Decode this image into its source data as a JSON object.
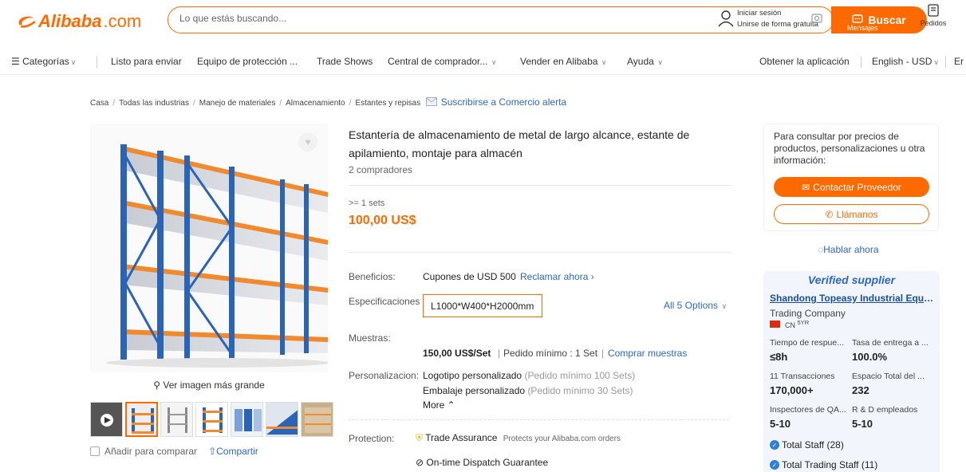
{
  "header": {
    "logo_text": "Alibaba",
    "logo_suffix": ".com",
    "search_placeholder": "Lo que estás buscando...",
    "signin_line1": "Iniciar sesión",
    "signin_line2": "Unirse de forma gratuita",
    "search_button": "Buscar",
    "messages_label": "Mensajes",
    "orders_label": "Pedidos"
  },
  "nav": {
    "categories": "Categorías",
    "items": [
      "Listo para enviar",
      "Equipo de protección ...",
      "Trade Shows",
      "Central de comprador...",
      "Vender en Alibaba",
      "Ayuda"
    ],
    "get_app": "Obtener la aplicación",
    "language": "English - USD",
    "more": "Er"
  },
  "breadcrumb": {
    "items": [
      "Casa",
      "Todas las industrias",
      "Manejo de materiales",
      "Almacenamiento",
      "Estantes y repisas"
    ],
    "subscribe": "Suscribirse a Comercio alerta"
  },
  "gallery": {
    "view_larger": "Ver imagen más grande",
    "compare": "Añadir para comparar",
    "share": "Compartir"
  },
  "product": {
    "title": "Estantería de almacenamiento de metal de largo alcance, estante de apilamiento, montaje para almacén",
    "buyers": "2 compradores",
    "moq": ">= 1 sets",
    "price": "100,00 US$",
    "benefits_label": "Beneficios:",
    "benefits_value": "Cupones de USD 500",
    "benefits_link": "Reclamar ahora",
    "specs_label": "Especificaciones",
    "specs_value": "L1000*W400*H2000mm",
    "specs_all": "All 5 Options",
    "samples_label": "Muestras:",
    "sample_price": "150,00 US$/Set",
    "sample_min": "Pedido mínimo : 1 Set",
    "sample_link": "Comprar muestras",
    "custom_label": "Personalizacion:",
    "custom_logo": "Logotipo personalizado",
    "custom_logo_min": "(Pedido mínimo 100 Sets)",
    "custom_pack": "Embalaje personalizado",
    "custom_pack_min": "(Pedido mínimo 30 Sets)",
    "more": "More",
    "protection_label": "Protection:",
    "trade_assurance": "Trade Assurance",
    "trade_assurance_desc": "Protects your Alibaba.com orders",
    "dispatch": "On-time Dispatch Guarantee"
  },
  "contact": {
    "info": "Para consultar por precios de productos, personalizaciones u otra información:",
    "contact_button": "Contactar Proveedor",
    "call_button": "Llámanos",
    "chat": "Hablar ahora"
  },
  "supplier": {
    "verified": "Verified supplier",
    "name": "Shandong Topeasy Industrial Equip...",
    "type": "Trading Company",
    "country": "CN",
    "years": "5YR",
    "metrics": [
      {
        "label": "Tiempo de respue...",
        "value": "≤8h"
      },
      {
        "label": "Tasa de entrega a ...",
        "value": "100.0%"
      },
      {
        "label": "11 Transacciones",
        "value": "170,000+"
      },
      {
        "label": "Espacio Total del ...",
        "value": "232"
      },
      {
        "label": "Inspectores de QA...",
        "value": "5-10"
      },
      {
        "label": "R & D empleados",
        "value": "5-10"
      }
    ],
    "total_staff": "Total Staff (28)",
    "total_trading_staff": "Total Trading Staff (11)"
  },
  "colors": {
    "accent": "#ff6a00",
    "link": "#2d68c4",
    "rack_blue": "#2a64b8",
    "rack_orange": "#f08a2c"
  }
}
